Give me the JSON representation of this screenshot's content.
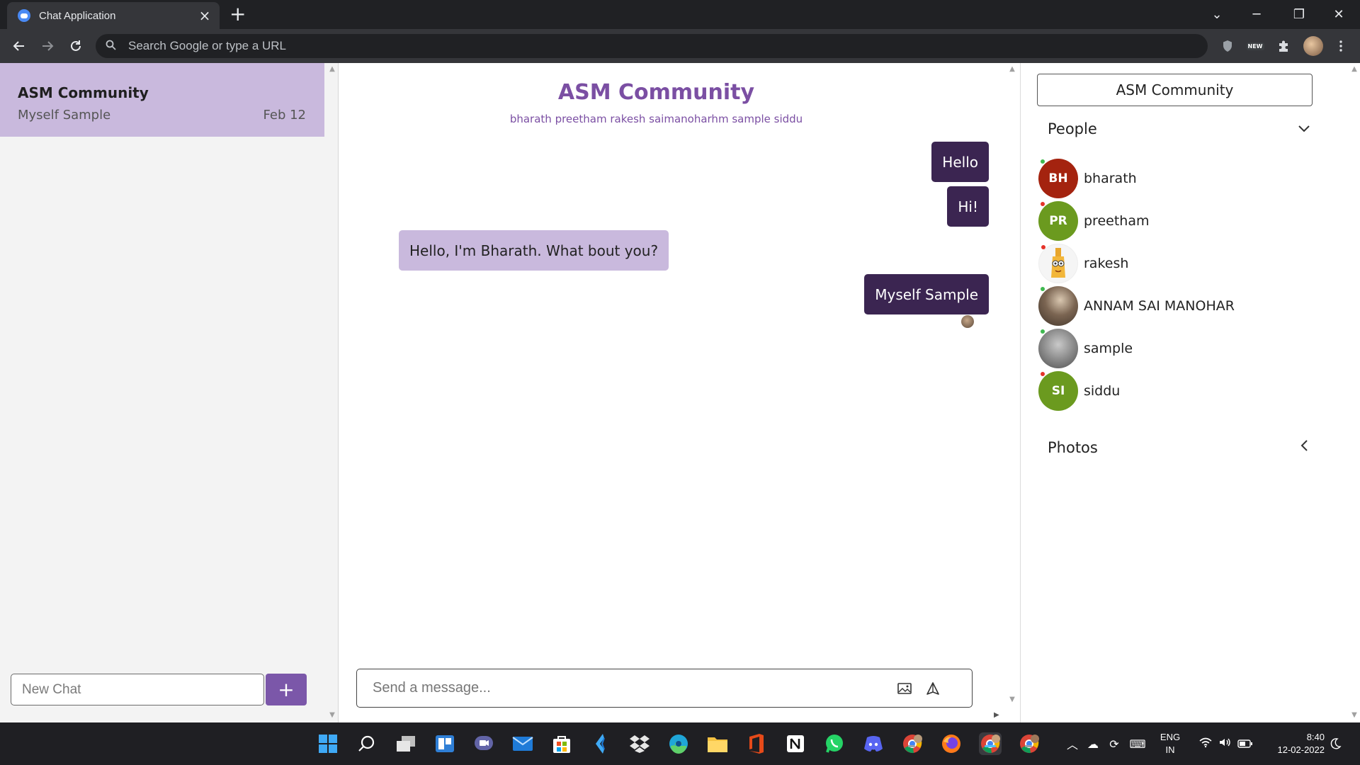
{
  "browser": {
    "tab_title": "Chat Application",
    "tab_close": "×",
    "new_tab": "+",
    "omnibox_placeholder": "Search Google or type a URL",
    "ext_badge": "NEW",
    "win_min": "─",
    "win_restore": "❐",
    "win_close": "✕",
    "tab_search": "⌄"
  },
  "left_panel": {
    "chats": [
      {
        "name": "ASM Community",
        "last_sender": "Myself Sample",
        "date": "Feb 12"
      }
    ],
    "new_chat_placeholder": "New Chat",
    "add_button": "+"
  },
  "conversation": {
    "title": "ASM Community",
    "members": "bharath preetham rakesh saimanoharhm sample siddu",
    "messages": [
      {
        "text": "Hello",
        "direction": "out"
      },
      {
        "text": "Hi!",
        "direction": "out"
      },
      {
        "text": "Hello, I'm Bharath. What bout you?",
        "direction": "in"
      },
      {
        "text": "Myself Sample",
        "direction": "out"
      }
    ],
    "composer_placeholder": "Send a message..."
  },
  "right_panel": {
    "group_button": "ASM Community",
    "people_heading": "People",
    "photos_heading": "Photos",
    "people": [
      {
        "initials": "BH",
        "name": "bharath",
        "color": "#a4230f",
        "status": "#3fb950"
      },
      {
        "initials": "PR",
        "name": "preetham",
        "color": "#6b9a1f",
        "status": "#e5332a"
      },
      {
        "initials": "",
        "name": "rakesh",
        "color": "#ffffff",
        "status": "#e5332a"
      },
      {
        "initials": "",
        "name": "ANNAM SAI MANOHAR",
        "color": "#6b5a4b",
        "status": "#3fb950"
      },
      {
        "initials": "",
        "name": "sample",
        "color": "#8c8c8c",
        "status": "#3fb950"
      },
      {
        "initials": "SI",
        "name": "siddu",
        "color": "#6b9a1f",
        "status": "#e5332a"
      }
    ]
  },
  "taskbar": {
    "lang_line1": "ENG",
    "lang_line2": "IN",
    "time": "8:40",
    "date": "12-02-2022"
  },
  "colors": {
    "accent": "#7b4fa3",
    "outgoing_bubble": "#3b2551",
    "incoming_bubble": "#c9b9dd",
    "selected_chat": "#c9b9dd"
  }
}
